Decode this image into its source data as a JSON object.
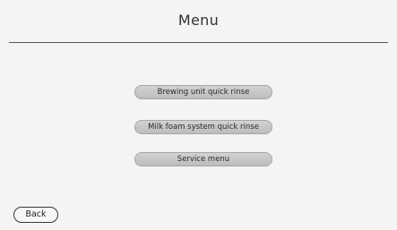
{
  "header": {
    "title": "Menu"
  },
  "menu": {
    "items": [
      {
        "label": "Brewing unit quick rinse"
      },
      {
        "label": "Milk foam system quick rinse"
      },
      {
        "label": "Service menu"
      }
    ]
  },
  "footer": {
    "back_label": "Back"
  }
}
